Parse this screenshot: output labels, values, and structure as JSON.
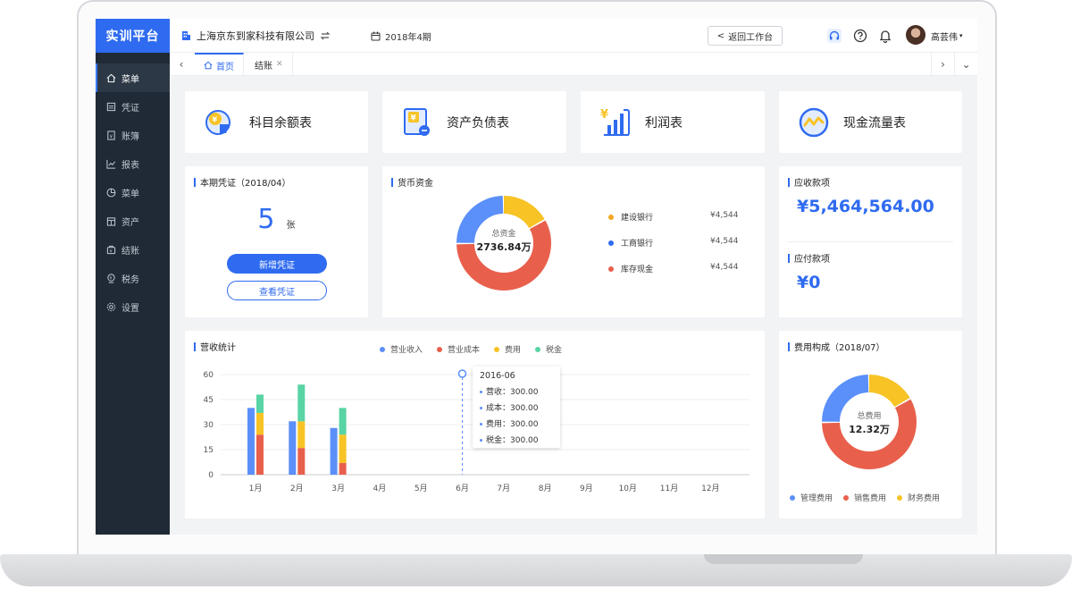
{
  "app": {
    "brand": "实训平台"
  },
  "header": {
    "company": "上海京东到家科技有限公司",
    "period": "2018年4期",
    "return_label": "返回工作台",
    "username": "高芸伟"
  },
  "sidebar": {
    "items": [
      {
        "label": "菜单",
        "icon": "home-icon"
      },
      {
        "label": "凭证",
        "icon": "voucher-icon"
      },
      {
        "label": "账簿",
        "icon": "book-icon"
      },
      {
        "label": "报表",
        "icon": "chart-icon"
      },
      {
        "label": "菜单",
        "icon": "pie-icon"
      },
      {
        "label": "资产",
        "icon": "asset-icon"
      },
      {
        "label": "结账",
        "icon": "checkout-icon"
      },
      {
        "label": "税务",
        "icon": "tax-icon"
      },
      {
        "label": "设置",
        "icon": "gear-icon"
      }
    ]
  },
  "tabs": [
    {
      "label": "首页"
    },
    {
      "label": "结账"
    }
  ],
  "shortcuts": [
    {
      "label": "科目余额表",
      "icon": "subject-balance-icon"
    },
    {
      "label": "资产负债表",
      "icon": "balance-sheet-icon"
    },
    {
      "label": "利润表",
      "icon": "profit-icon"
    },
    {
      "label": "现金流量表",
      "icon": "cashflow-icon"
    }
  ],
  "voucher": {
    "title": "本期凭证（2018/04）",
    "count": "5",
    "unit": "张",
    "add_label": "新增凭证",
    "view_label": "查看凭证"
  },
  "funds": {
    "title": "货币资金",
    "center_label": "总资金",
    "center_value": "2736.84万",
    "items": [
      {
        "name": "建设银行",
        "value": "¥4,544",
        "color": "#f5a623"
      },
      {
        "name": "工商银行",
        "value": "¥4,544",
        "color": "#2f6bf0"
      },
      {
        "name": "库存现金",
        "value": "¥4,544",
        "color": "#e8604c"
      }
    ],
    "slices": [
      {
        "share": 0.17,
        "color": "#f7c325"
      },
      {
        "share": 0.58,
        "color": "#e8604c"
      },
      {
        "share": 0.25,
        "color": "#5b8ff9"
      }
    ]
  },
  "receivable": {
    "title": "应收款项",
    "value": "¥5,464,564.00"
  },
  "payable": {
    "title": "应付款项",
    "value": "¥0"
  },
  "revenue": {
    "title": "营收统计"
  },
  "expense": {
    "title": "费用构成（2018/07）",
    "center_label": "总费用",
    "center_value": "12.32万",
    "legend": [
      {
        "name": "管理费用",
        "color": "#5b8ff9"
      },
      {
        "name": "销售费用",
        "color": "#e8604c"
      },
      {
        "name": "财务费用",
        "color": "#f7c325"
      }
    ],
    "slices": [
      {
        "share": 0.17,
        "color": "#f7c325"
      },
      {
        "share": 0.58,
        "color": "#e8604c"
      },
      {
        "share": 0.25,
        "color": "#5b8ff9"
      }
    ]
  },
  "chart_data": {
    "type": "bar",
    "categories": [
      "1月",
      "2月",
      "3月",
      "4月",
      "5月",
      "6月",
      "7月",
      "8月",
      "9月",
      "10月",
      "11月",
      "12月"
    ],
    "ylim": [
      0,
      60
    ],
    "yticks": [
      0,
      15,
      30,
      45,
      60
    ],
    "legend_position": "top",
    "series": [
      {
        "name": "营业收入",
        "color": "#5b8ff9",
        "stack": "a",
        "values": [
          40,
          32,
          28,
          null,
          null,
          null,
          null,
          null,
          null,
          null,
          null,
          null
        ]
      },
      {
        "name": "营业成本",
        "color": "#e8604c",
        "stack": "b",
        "values": [
          24,
          16,
          7,
          null,
          null,
          null,
          null,
          null,
          null,
          null,
          null,
          null
        ]
      },
      {
        "name": "费用",
        "color": "#f7c325",
        "stack": "b",
        "values": [
          13,
          16,
          17,
          null,
          null,
          null,
          null,
          null,
          null,
          null,
          null,
          null
        ]
      },
      {
        "name": "税金",
        "color": "#59d4a4",
        "stack": "b",
        "values": [
          11,
          22,
          16,
          null,
          null,
          null,
          null,
          null,
          null,
          null,
          null,
          null
        ]
      }
    ],
    "tooltip": {
      "title": "2016-06",
      "category": "6月",
      "rows": [
        {
          "label": "营收：",
          "value": "300.00"
        },
        {
          "label": "成本：",
          "value": "300.00"
        },
        {
          "label": "费用：",
          "value": "300.00"
        },
        {
          "label": "税金：",
          "value": "300.00"
        }
      ]
    }
  }
}
